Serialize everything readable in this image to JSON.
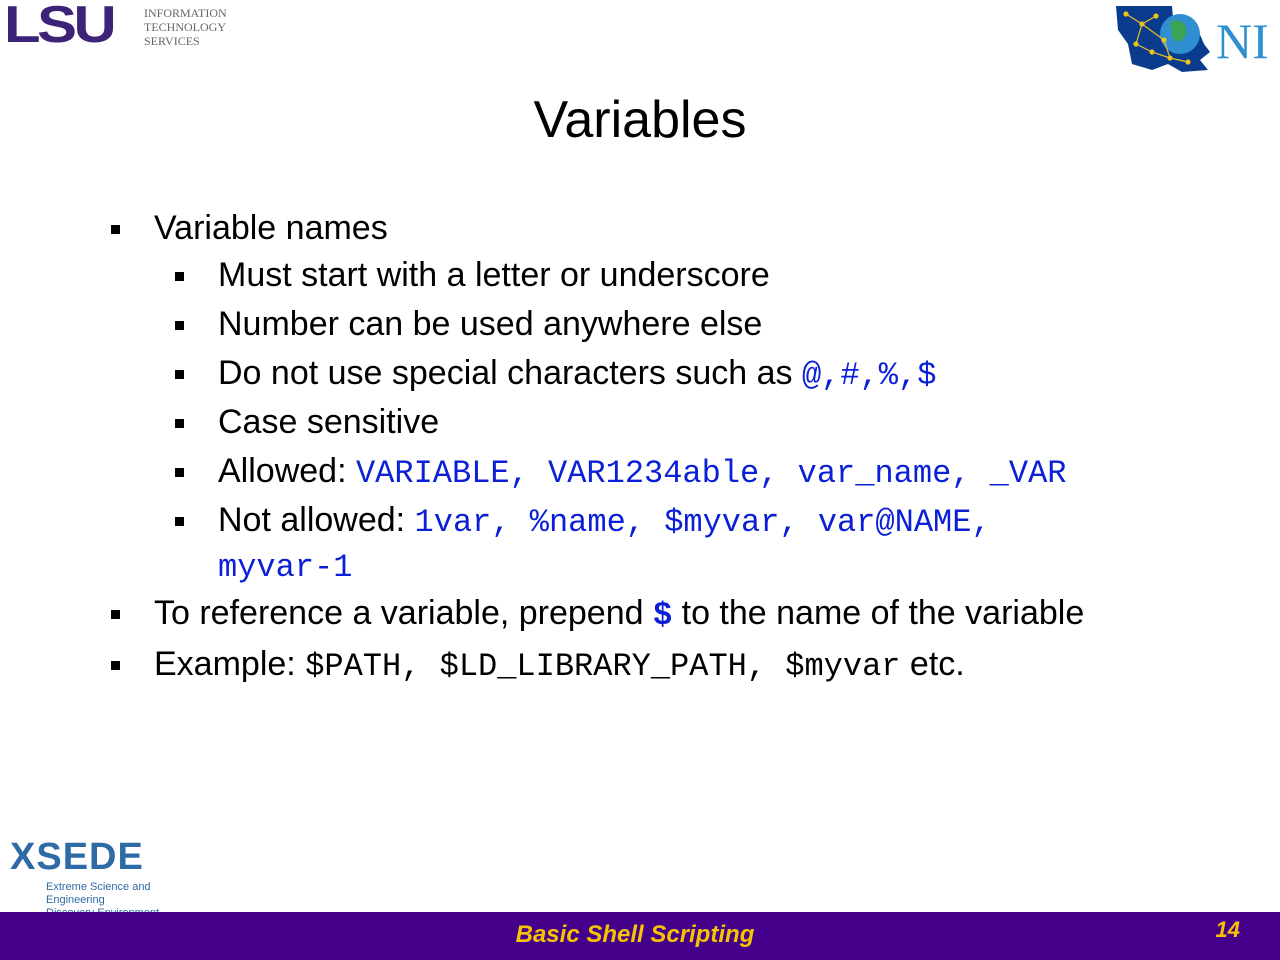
{
  "header": {
    "lsu_mark": "LSU",
    "lsu_sub": [
      "INFORMATION",
      "TECHNOLOGY",
      "SERVICES"
    ],
    "loni_text": "NI"
  },
  "title": "Variables",
  "bullets": {
    "names": "Variable names",
    "rule1": "Must start with a letter or underscore",
    "rule2": "Number can be used anywhere else",
    "rule3_text": "Do not use special characters such as ",
    "rule3_code": "@,#,%,$",
    "rule4": "Case sensitive",
    "allowed_label": "Allowed: ",
    "allowed_code": "VARIABLE, VAR1234able, var_name, _VAR",
    "notallowed_label": "Not allowed: ",
    "notallowed_code_1": "1var, %name, $myvar, var@NAME,",
    "notallowed_code_2": "myvar-1",
    "reference_pre": "To reference a variable, prepend ",
    "reference_code": "$",
    "reference_post": " to the name of the variable",
    "example_label": "Example: ",
    "example_code": "$PATH, $LD_LIBRARY_PATH, $myvar",
    "example_post": " etc."
  },
  "xsede": {
    "word": "XSEDE",
    "sub_1": "Extreme Science and Engineering",
    "sub_2": "Discovery Environment"
  },
  "footer": {
    "title": "Basic Shell Scripting",
    "page": "14"
  },
  "colors": {
    "footer_bg": "#44008b",
    "footer_text": "#f6c400",
    "code_blue": "#0a1fd6",
    "lsu_purple": "#3d2378"
  }
}
